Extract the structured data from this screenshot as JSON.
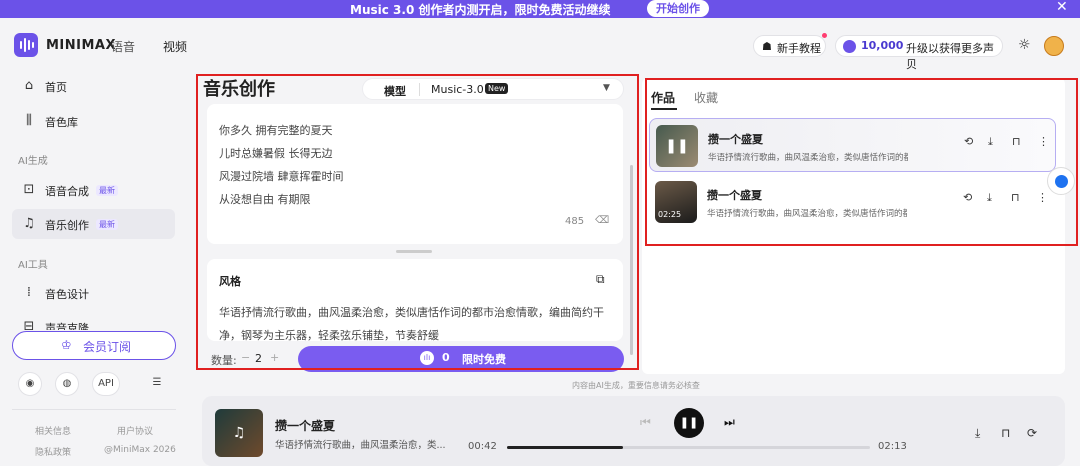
{
  "banner": {
    "text": "Music 3.0 创作者内测开启，限时免费活动继续",
    "button": "开始创作",
    "close": "✕"
  },
  "topnav": {
    "brand": "MINIMAX",
    "nav": [
      "语音",
      "视频"
    ],
    "tutorial": "新手教程",
    "credits": "10,000",
    "upgrade": "升级以获得更多声贝"
  },
  "sidebar": {
    "items": [
      {
        "label": "首页",
        "icon": "home-icon",
        "glyph": "⌂"
      },
      {
        "label": "音色库",
        "icon": "library-icon",
        "glyph": "⫼"
      }
    ],
    "section_ai_gen": "AI生成",
    "gen_items": [
      {
        "label": "语音合成",
        "badge": "最新",
        "icon": "voice-synth-icon",
        "glyph": "⊡"
      },
      {
        "label": "音乐创作",
        "badge": "最新",
        "icon": "music-note-icon",
        "glyph": "♫"
      }
    ],
    "section_ai_tools": "AI工具",
    "tool_items": [
      {
        "label": "音色设计",
        "icon": "sound-design-icon",
        "glyph": "⁞"
      },
      {
        "label": "声音克隆",
        "icon": "voice-clone-icon",
        "glyph": "⊟"
      }
    ],
    "subscribe": "会员订阅",
    "social": {
      "api": "API"
    },
    "footer": {
      "info": "相关信息",
      "agreement": "用户协议",
      "privacy": "隐私政策",
      "copyright": "@MiniMax 2026"
    }
  },
  "center": {
    "title": "音乐创作",
    "model_label": "模型",
    "model_value": "Music-3.0",
    "model_badge": "New",
    "lyrics": [
      "你多久 拥有完整的夏天",
      "儿时总嫌暑假 长得无边",
      "风漫过院墙 肆意挥霍时间",
      "从没想自由 有期限"
    ],
    "lyrics_count": "485",
    "style_title": "风格",
    "style_text": "华语抒情流行歌曲，曲风温柔治愈，类似唐恬作词的都市治愈情歌，编曲简约干净，钢琴为主乐器，轻柔弦乐铺垫，节奏舒缓",
    "quantity_label": "数量:",
    "quantity_minus": "−",
    "quantity_value": "2",
    "quantity_plus": "+",
    "generate_count": "0",
    "generate_label": "限时免费",
    "disclaimer": "内容由AI生成，重要信息请务必核查"
  },
  "right": {
    "tabs": [
      "作品",
      "收藏"
    ],
    "works": [
      {
        "title": "攒一个盛夏",
        "desc": "华语抒情流行歌曲，曲风温柔治愈，类似唐恬作词的都市治愈情歌",
        "duration": "",
        "state": "playing"
      },
      {
        "title": "攒一个盛夏",
        "desc": "华语抒情流行歌曲，曲风温柔治愈，类似唐恬作词的都市治愈情歌",
        "duration": "02:25",
        "state": "idle"
      }
    ]
  },
  "player": {
    "title": "攒一个盛夏",
    "desc": "华语抒情流行歌曲，曲风温柔治愈，类...",
    "current": "00:42",
    "total": "02:13",
    "progress": 0.32
  },
  "colors": {
    "accent": "#6b52e8",
    "highlight": "#e02020"
  }
}
